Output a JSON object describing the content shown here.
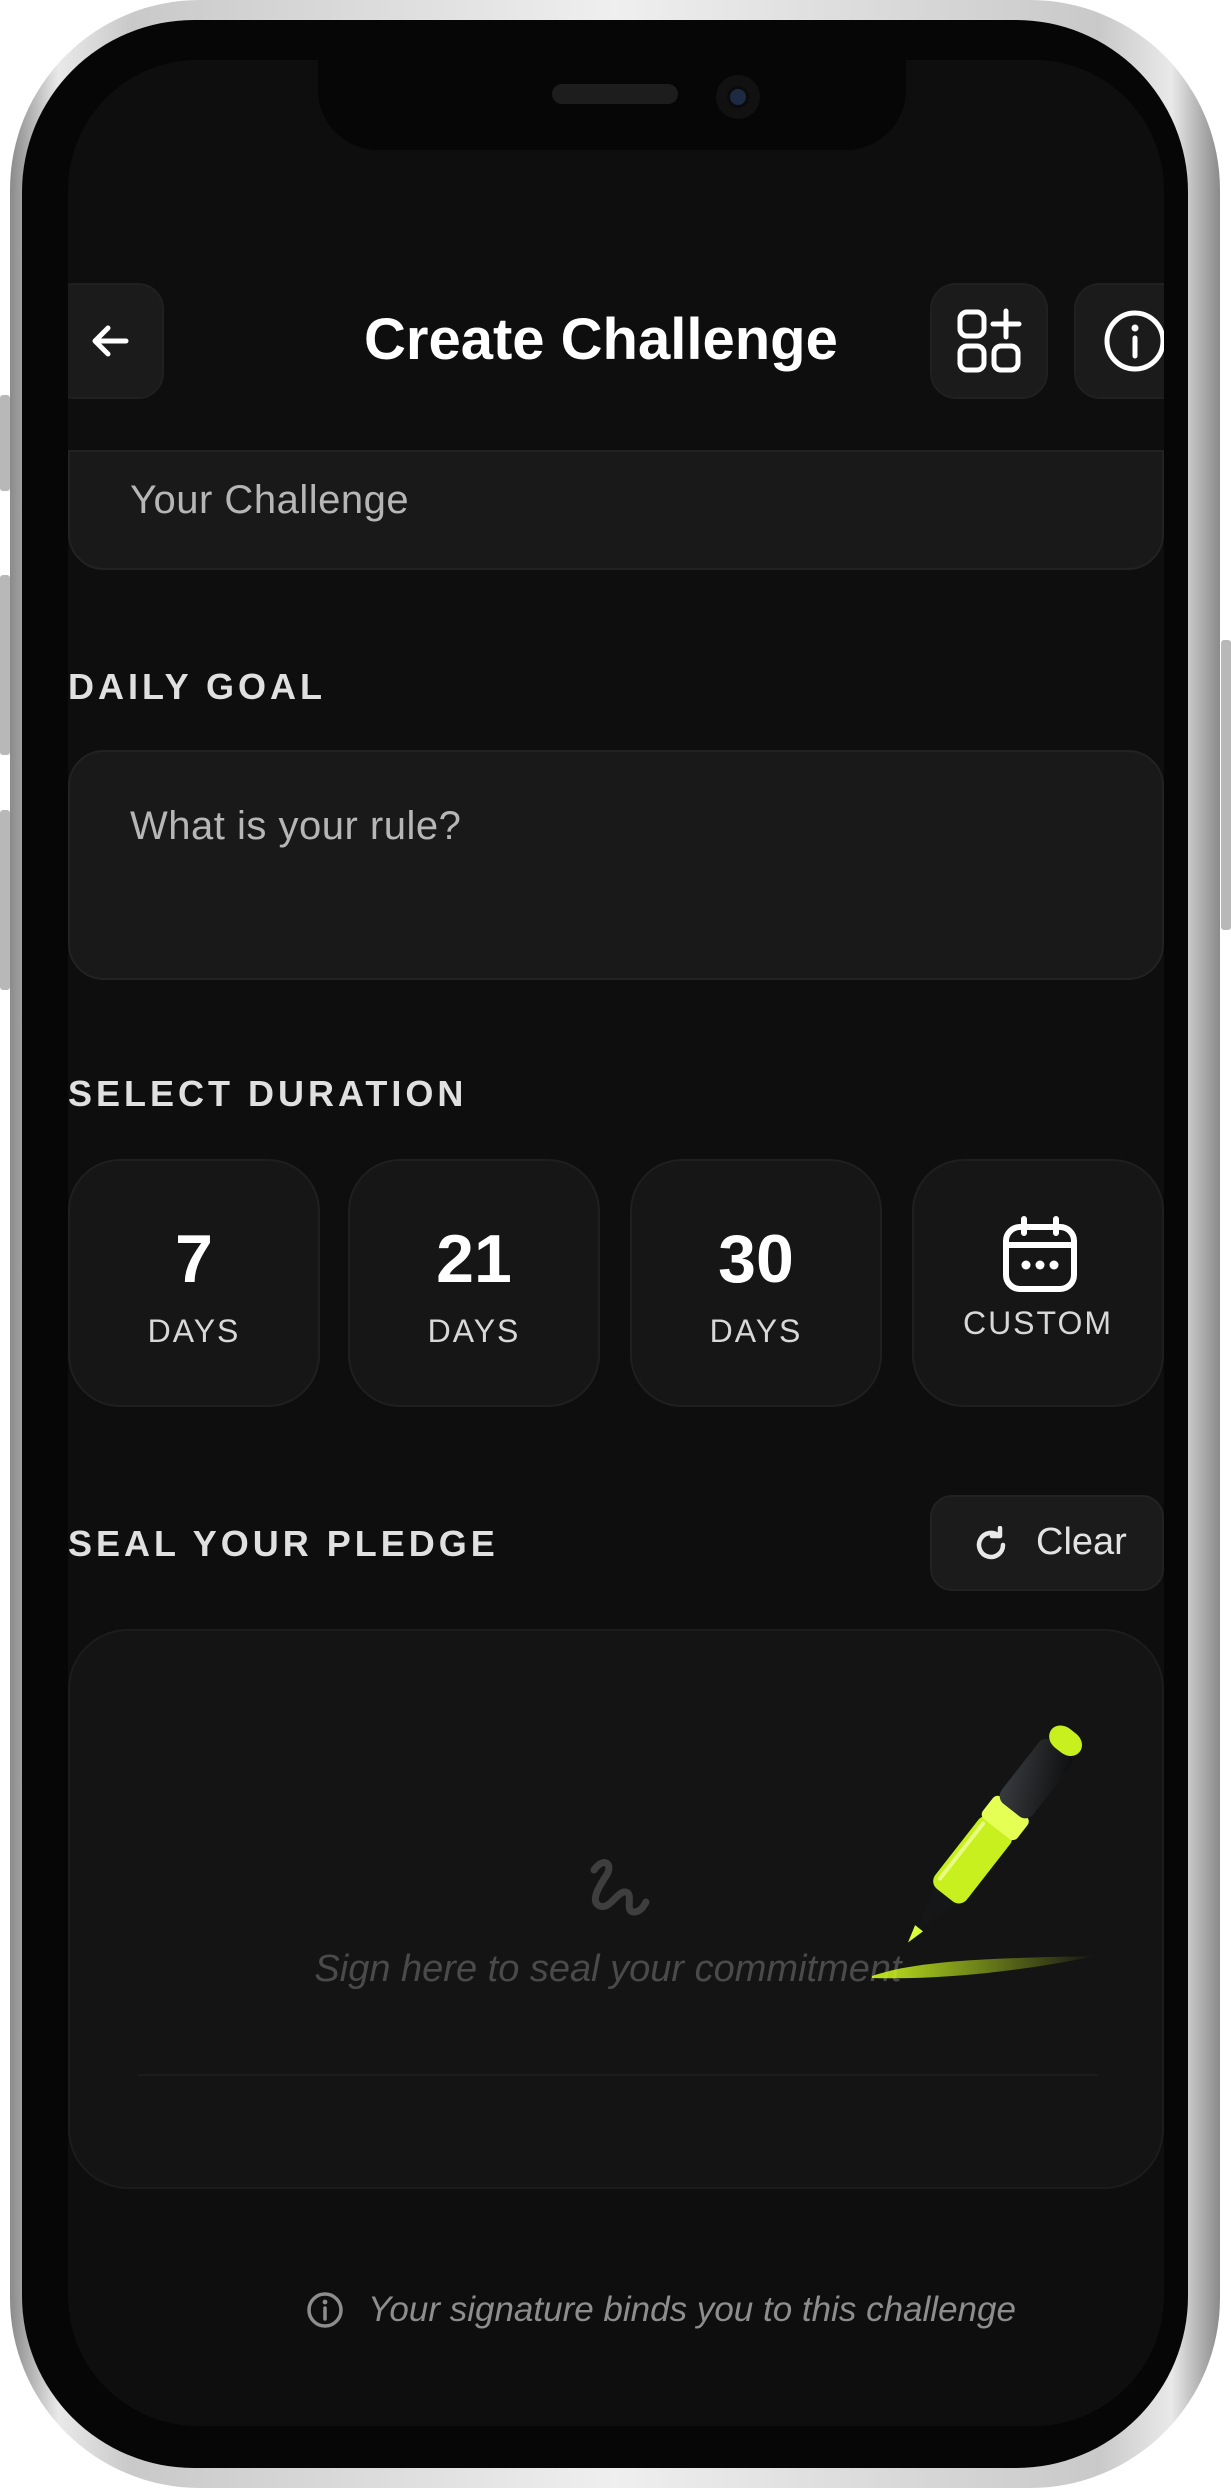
{
  "header": {
    "title": "Create Challenge"
  },
  "challenge_name": {
    "value": "Your Challenge"
  },
  "daily_goal": {
    "label": "DAILY GOAL",
    "placeholder": "What is your rule?"
  },
  "duration": {
    "label": "SELECT DURATION",
    "options": [
      {
        "number": "7",
        "unit": "DAYS"
      },
      {
        "number": "21",
        "unit": "DAYS"
      },
      {
        "number": "30",
        "unit": "DAYS"
      },
      {
        "unit": "CUSTOM",
        "icon": "calendar-icon"
      }
    ]
  },
  "pledge": {
    "label": "SEAL YOUR PLEDGE",
    "clear_label": "Clear",
    "placeholder": "Sign here to seal your commitment",
    "footer_note": "Your signature binds you to this challenge"
  },
  "colors": {
    "background": "#0e0e0e",
    "card": "#191919",
    "accent": "#c8f01e"
  }
}
